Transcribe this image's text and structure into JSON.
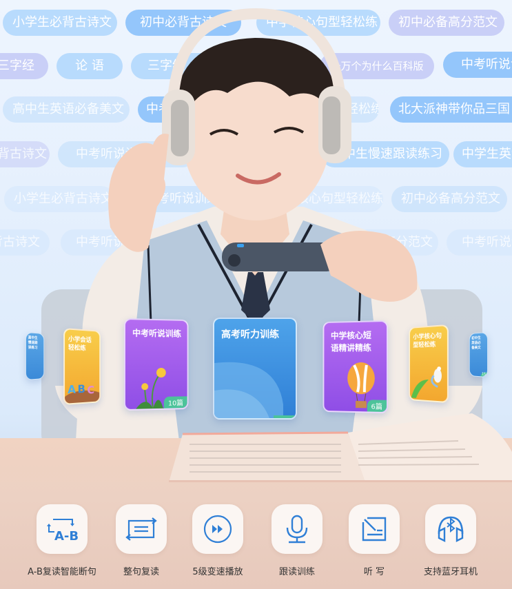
{
  "background_tags": {
    "row1": [
      {
        "label": "小学生必背古诗文",
        "style": "blue"
      },
      {
        "label": "初中必背古诗文",
        "style": "blue2"
      },
      {
        "label": "中学核心句型轻松练",
        "style": "blue"
      },
      {
        "label": "初中必备高分范文",
        "style": "lav"
      }
    ],
    "row2": [
      {
        "label": "三字经",
        "style": "lav"
      },
      {
        "label": "论 语",
        "style": "blue"
      },
      {
        "label": "三字经",
        "style": "blue"
      },
      {
        "label": "十万个为什么百科版",
        "style": "lav"
      },
      {
        "label": "中考听说训练",
        "style": "blue2"
      }
    ],
    "row3": [
      {
        "label": "高中生英语必备美文",
        "style": "faint"
      },
      {
        "label": "中考听说训练",
        "style": "blue2"
      },
      {
        "label": "中学核心句型轻松练",
        "style": "faint"
      },
      {
        "label": "北大派神带你品三国",
        "style": "blue2"
      }
    ],
    "row4": [
      {
        "label": "小学生必背古诗文",
        "style": "lav"
      },
      {
        "label": "中考听说训练",
        "style": "faint"
      },
      {
        "label": "高中生慢速跟读练习",
        "style": "blue"
      },
      {
        "label": "中学生英语必备美文",
        "style": "blue"
      }
    ],
    "row5": [
      {
        "label": "小学生必背古诗文",
        "style": "fainter"
      },
      {
        "label": "中考听说训练",
        "style": "faint"
      },
      {
        "label": "中学核心句型轻松练",
        "style": "fainter"
      },
      {
        "label": "初中必备高分范文",
        "style": "faint"
      }
    ],
    "row6": [
      {
        "label": "小学生必背古诗文",
        "style": "fainter"
      },
      {
        "label": "中考听说训练",
        "style": "fainter"
      },
      {
        "label": "初中必备高分范文",
        "style": "fainter"
      },
      {
        "label": "中考听说训练",
        "style": "fainter"
      }
    ]
  },
  "cards": [
    {
      "title": "高中生慢速跟读练习",
      "badge": "",
      "color_top": "#5aa6e6",
      "color_bottom": "#3b8ad8"
    },
    {
      "title": "小学会话轻松练",
      "badge": "",
      "color_top": "#f7c946",
      "color_bottom": "#f3a92f"
    },
    {
      "title": "中考听说训练",
      "badge": "10篇",
      "color_top": "#b36bf0",
      "color_bottom": "#8f4ee6"
    },
    {
      "title": "高考听力训练",
      "badge": "",
      "color_top": "#4ea3ea",
      "color_bottom": "#2f7fd6"
    },
    {
      "title": "中学核心短语精讲精练",
      "badge": "6篇",
      "color_top": "#b36bf0",
      "color_bottom": "#8f4ee6"
    },
    {
      "title": "小学核心句型轻松练",
      "badge": "",
      "color_top": "#f7c946",
      "color_bottom": "#f3a92f"
    },
    {
      "title": "初中生英语必备美文",
      "badge": "15",
      "color_top": "#5aa6e6",
      "color_bottom": "#3b8ad8"
    }
  ],
  "features": [
    {
      "label": "A-B复读智能断句",
      "icon": "ab-repeat-icon"
    },
    {
      "label": "整句复读",
      "icon": "sentence-repeat-icon"
    },
    {
      "label": "5级变速播放",
      "icon": "fast-forward-icon"
    },
    {
      "label": "跟读训练",
      "icon": "microphone-icon"
    },
    {
      "label": "听 写",
      "icon": "dictation-icon"
    },
    {
      "label": "支持蓝牙耳机",
      "icon": "bluetooth-headphones-icon"
    }
  ],
  "colors": {
    "icon_blue": "#2f7fd6",
    "feature_text": "#333333",
    "badge_green": "#4cc39a"
  }
}
